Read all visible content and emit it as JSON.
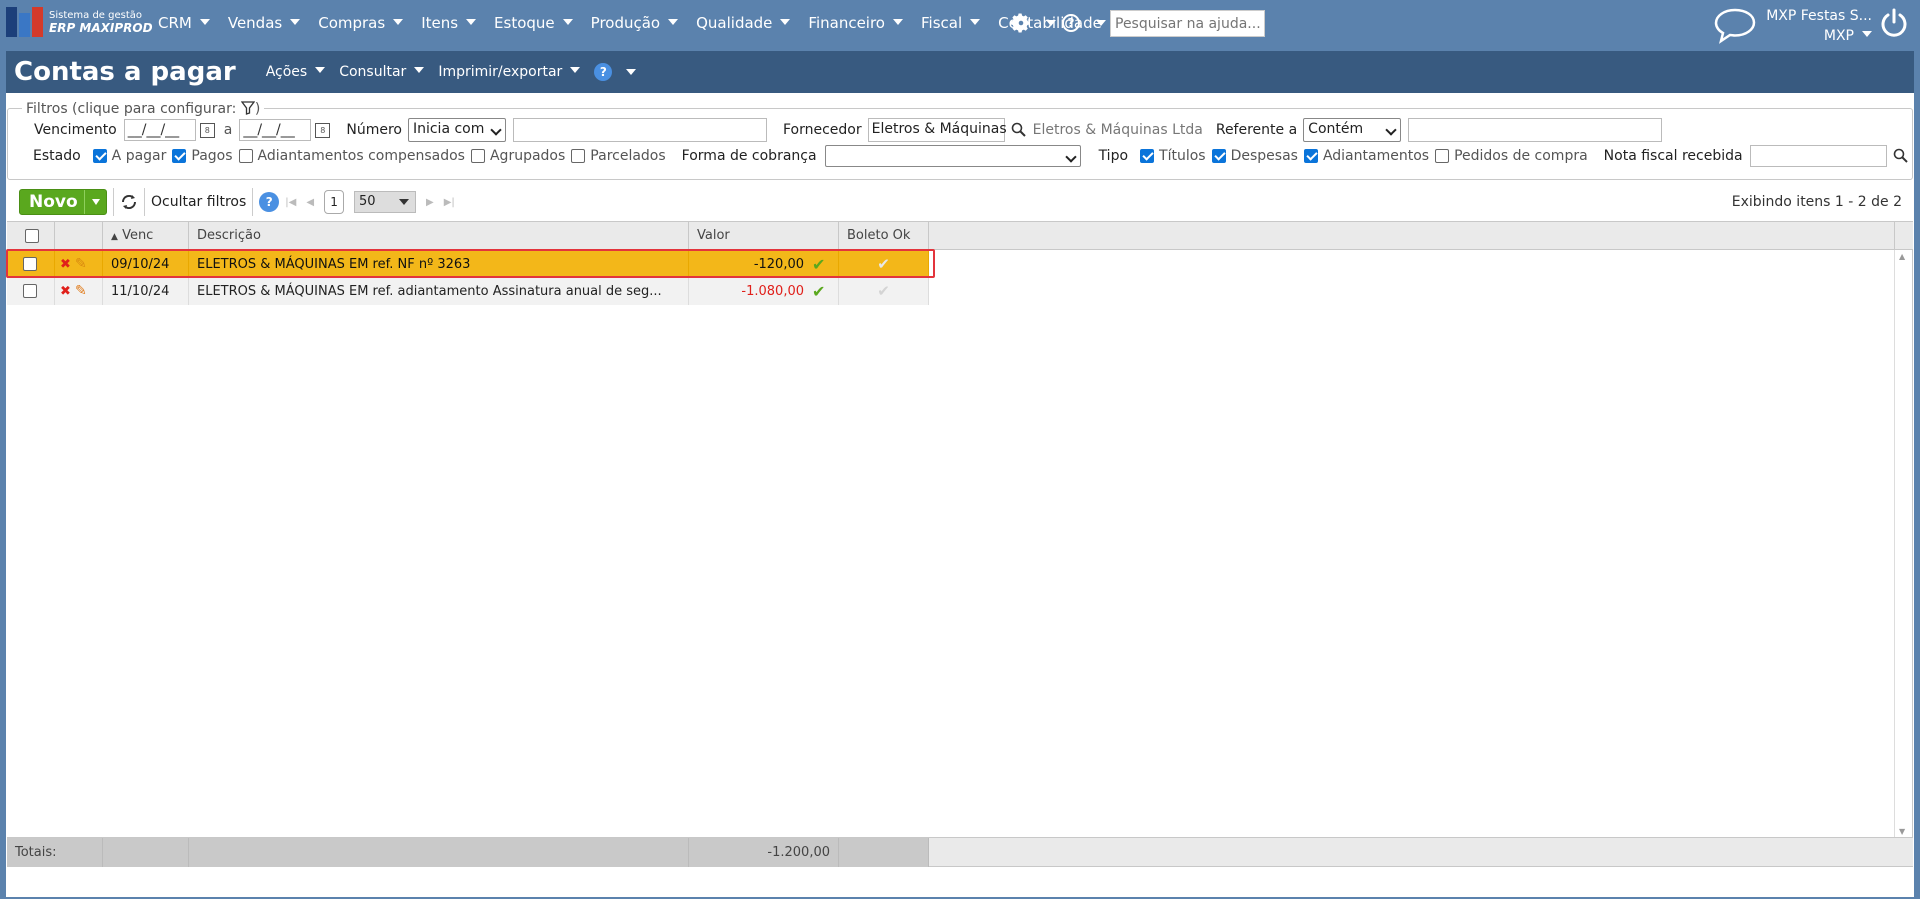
{
  "logo": {
    "line1": "Sistema de gestão",
    "line2": "ERP MAXIPROD"
  },
  "menu": [
    "CRM",
    "Vendas",
    "Compras",
    "Itens",
    "Estoque",
    "Produção",
    "Qualidade",
    "Financeiro",
    "Fiscal",
    "Contabilidade"
  ],
  "help_search": {
    "placeholder": "Pesquisar na ajuda..."
  },
  "user": {
    "company": "MXP Festas S...",
    "account": "MXP"
  },
  "page": {
    "title": "Contas a pagar",
    "menus": [
      "Ações",
      "Consultar",
      "Imprimir/exportar"
    ]
  },
  "filters": {
    "legend": "Filtros (clique para configurar:",
    "legend_end": ")",
    "vencimento_label": "Vencimento",
    "date_from": "__/__/__",
    "date_sep": "a",
    "date_to": "__/__/__",
    "numero_label": "Número",
    "numero_mode": "Inicia com",
    "numero_value": "",
    "fornecedor_label": "Fornecedor",
    "fornecedor_value": "Eletros & Máquinas",
    "fornecedor_name": "Eletros & Máquinas Ltda",
    "referente_label": "Referente a",
    "referente_mode": "Contém",
    "referente_value": "",
    "estado_label": "Estado",
    "estado_options": [
      {
        "label": "A pagar",
        "checked": true
      },
      {
        "label": "Pagos",
        "checked": true
      },
      {
        "label": "Adiantamentos compensados",
        "checked": false
      },
      {
        "label": "Agrupados",
        "checked": false
      },
      {
        "label": "Parcelados",
        "checked": false
      }
    ],
    "forma_label": "Forma de cobrança",
    "forma_value": "",
    "tipo_label": "Tipo",
    "tipo_options": [
      {
        "label": "Títulos",
        "checked": true
      },
      {
        "label": "Despesas",
        "checked": true
      },
      {
        "label": "Adiantamentos",
        "checked": true
      },
      {
        "label": "Pedidos de compra",
        "checked": false
      }
    ],
    "nf_label": "Nota fiscal recebida",
    "nf_value": ""
  },
  "toolbar": {
    "novo_label": "Novo",
    "ocultar_label": "Ocultar filtros",
    "page_number": "1",
    "page_size": "50",
    "exibindo": "Exibindo itens 1 - 2 de 2"
  },
  "table": {
    "headers": {
      "venc": "Venc",
      "descricao": "Descrição",
      "valor": "Valor",
      "boleto": "Boleto Ok"
    },
    "rows": [
      {
        "venc": "09/10/24",
        "descricao": "ELETROS & MÁQUINAS EM ref. NF nº 3263",
        "valor": "-120,00"
      },
      {
        "venc": "11/10/24",
        "descricao": "ELETROS & MÁQUINAS EM ref. adiantamento Assinatura anual de seg...",
        "valor": "-1.080,00"
      }
    ],
    "totais_label": "Totais:",
    "totais_valor": "-1.200,00"
  },
  "colors": {
    "accent": "#385a80",
    "selected_row": "#f3b719",
    "negative": "#e0201b",
    "highlight": "#e3343c"
  }
}
